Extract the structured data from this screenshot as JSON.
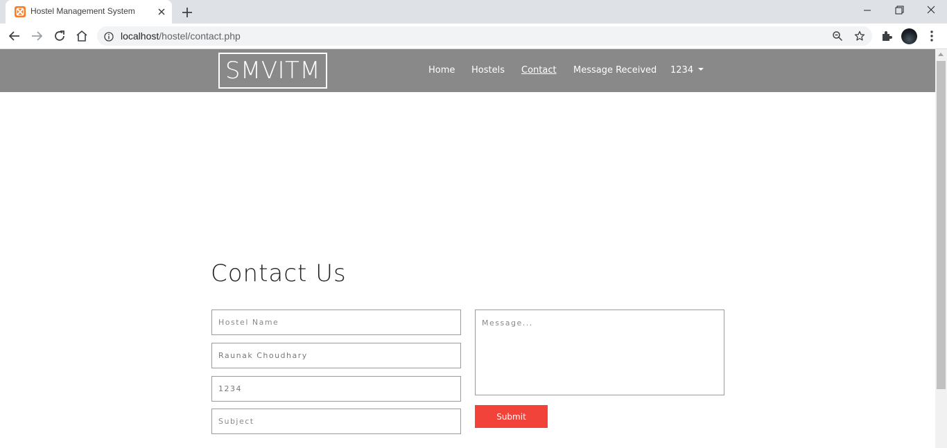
{
  "browser": {
    "tab_title": "Hostel Management System",
    "favicon": "xampp-icon",
    "url_host": "localhost",
    "url_path": "/hostel/contact.php",
    "accent": "#fb7a24"
  },
  "nav": {
    "logo": "SMVITM",
    "items": [
      "Home",
      "Hostels",
      "Contact",
      "Message Received"
    ],
    "active": "Contact",
    "user_label": "1234",
    "background": "#898989"
  },
  "contact": {
    "heading": "Contact Us",
    "fields": {
      "hostel_name": {
        "value": "",
        "placeholder": "Hostel Name"
      },
      "name": {
        "value": "Raunak Choudhary",
        "placeholder": ""
      },
      "id": {
        "value": "1234",
        "placeholder": ""
      },
      "subject": {
        "value": "",
        "placeholder": "Subject"
      }
    },
    "message_placeholder": "Message...",
    "submit_label": "Submit",
    "submit_color": "#f2433a"
  }
}
